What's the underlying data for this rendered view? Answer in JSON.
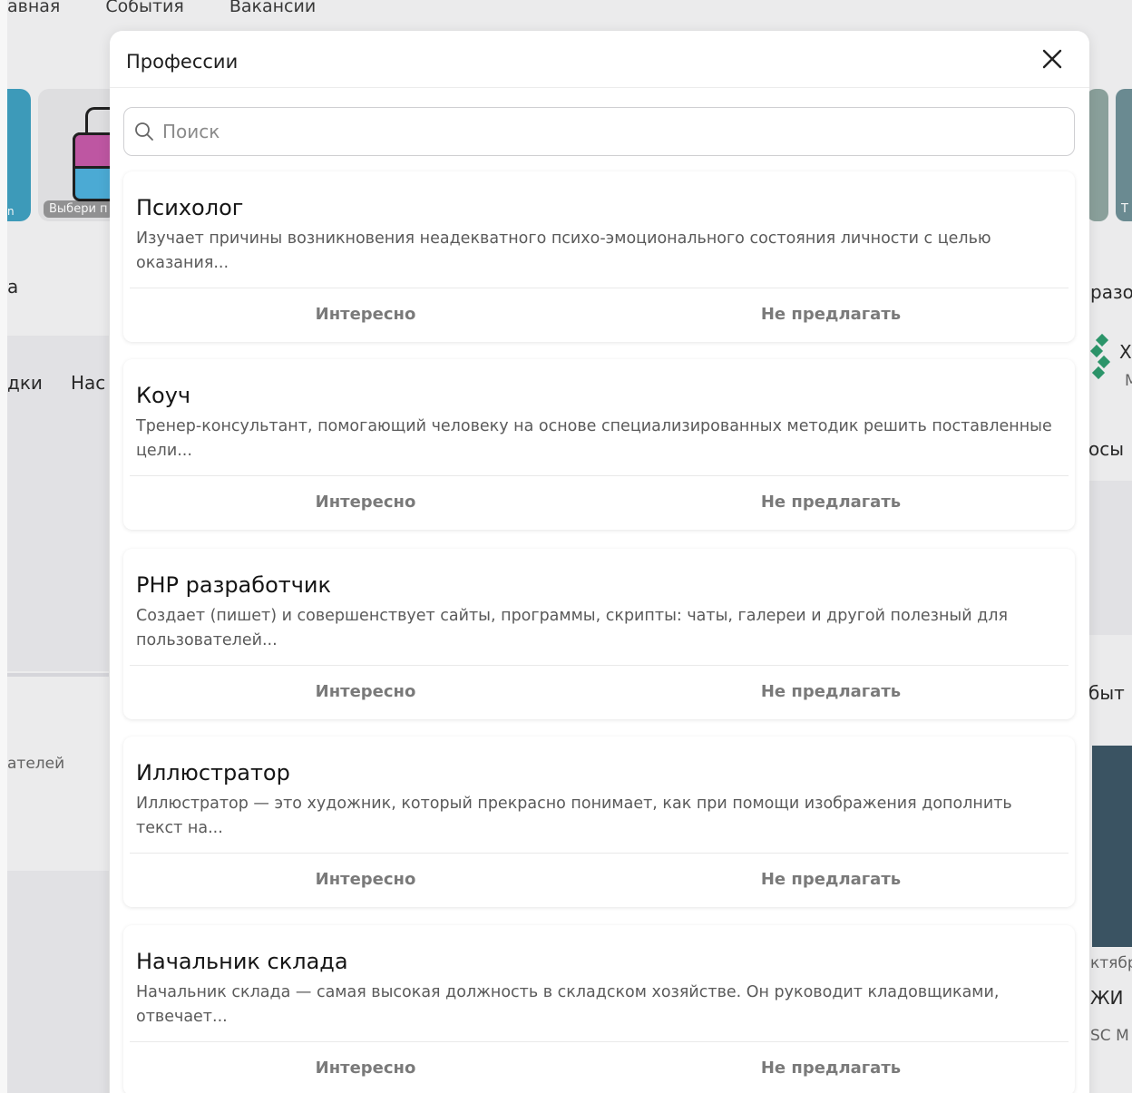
{
  "background": {
    "nav": [
      "авная",
      "События",
      "Вакансии"
    ],
    "card_caption_left": "n",
    "card_caption_bag": "Выбери п",
    "card_caption_right": "Т",
    "left_texts": [
      "а",
      "дки",
      "Нас",
      "ателей"
    ],
    "right_texts": [
      "разо",
      "Х",
      "М",
      "осы",
      "быт",
      "ктябр",
      "ЖИ",
      "SC M"
    ]
  },
  "modal": {
    "title": "Профессии",
    "search": {
      "placeholder": "Поиск",
      "value": ""
    },
    "professions": [
      {
        "title": "Психолог",
        "description": "Изучает причины возникновения неадекватного психо-эмоционального состояния личности с целью оказания...",
        "interest_label": "Интересно",
        "decline_label": "Не предлагать"
      },
      {
        "title": "Коуч",
        "description": "Тренер-консультант, помогающий человеку на основе специализированных методик решить поставленные цели...",
        "interest_label": "Интересно",
        "decline_label": "Не предлагать"
      },
      {
        "title": "PHP разработчик",
        "description": "Создает (пишет) и совершенствует сайты, программы, скрипты: чаты, галереи и другой полезный для пользователей...",
        "interest_label": "Интересно",
        "decline_label": "Не предлагать"
      },
      {
        "title": "Иллюстратор",
        "description": "Иллюстратор — это художник, который прекрасно понимает, как при помощи изображения дополнить текст на...",
        "interest_label": "Интересно",
        "decline_label": "Не предлагать"
      },
      {
        "title": "Начальник склада",
        "description": "Начальник склада — самая высокая должность в складском хозяйстве. Он руководит кладовщиками, отвечает...",
        "interest_label": "Интересно",
        "decline_label": "Не предлагать"
      }
    ]
  }
}
